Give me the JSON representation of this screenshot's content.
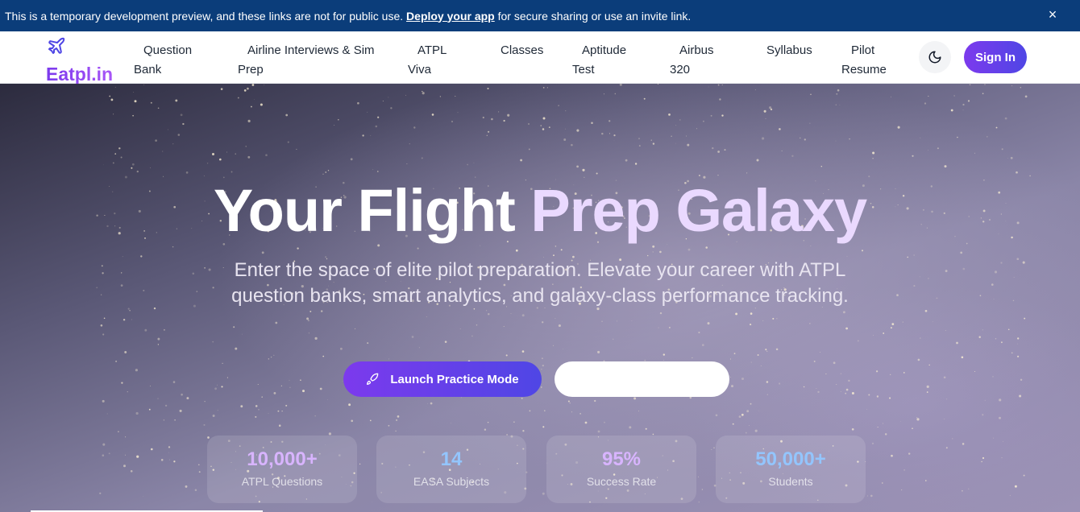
{
  "banner": {
    "text_before": "This is a temporary development preview, and these links are not for public use.",
    "link_text": "Deploy your app",
    "text_after": "for secure sharing or use an invite link.",
    "close_icon": "×"
  },
  "header": {
    "logo_text": "Eatpl.in",
    "logo_icon": "plane-icon",
    "nav": [
      {
        "line1": "Question",
        "line2": "Bank"
      },
      {
        "line1": "Airline Interviews & Sim",
        "line2": "Prep"
      },
      {
        "line1": "ATPL",
        "line2": "Viva"
      },
      {
        "line1": "Classes",
        "line2": ""
      },
      {
        "line1": "Aptitude",
        "line2": "Test"
      },
      {
        "line1": "Airbus",
        "line2": "320"
      },
      {
        "line1": "Syllabus",
        "line2": ""
      },
      {
        "line1": "Pilot",
        "line2": "Resume"
      }
    ],
    "theme_icon": "moon-icon",
    "signin_label": "Sign In"
  },
  "hero": {
    "title_white": "Your Flight",
    "title_grad": "Prep Galaxy",
    "subtitle": "Enter the space of elite pilot preparation. Elevate your career with ATPL question banks, smart analytics, and galaxy-class performance tracking.",
    "launch_label": "Launch Practice Mode",
    "launch_icon": "rocket-icon",
    "secondary_label": ""
  },
  "stats": [
    {
      "value": "10,000+",
      "label": "ATPL Questions",
      "color": "#d8b4fe"
    },
    {
      "value": "14",
      "label": "EASA Subjects",
      "color": "#93c5fd"
    },
    {
      "value": "95%",
      "label": "Success Rate",
      "color": "#d8b4fe"
    },
    {
      "value": "50,000+",
      "label": "Students",
      "color": "#93c5fd"
    }
  ],
  "colors": {
    "banner_bg": "#0b3d7a",
    "accent_purple": "#7c3aed",
    "accent_indigo": "#4f46e5"
  }
}
